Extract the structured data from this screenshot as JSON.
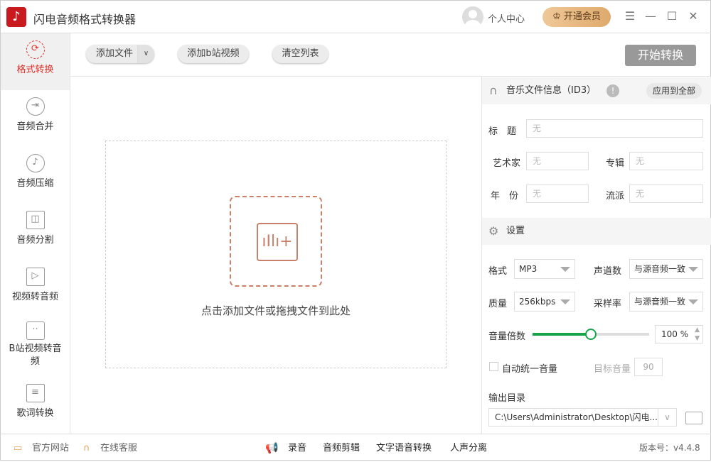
{
  "app": {
    "title": "闪电音频格式转换器",
    "user": "个人中心",
    "vip": "开通会员"
  },
  "sidebar": [
    {
      "label": "格式转换",
      "icon": "refresh-icon"
    },
    {
      "label": "音频合并",
      "icon": "merge-icon"
    },
    {
      "label": "音频压缩",
      "icon": "compress-icon"
    },
    {
      "label": "音频分割",
      "icon": "split-icon"
    },
    {
      "label": "视频转音频",
      "icon": "video-icon"
    },
    {
      "label": "B站视频转音频",
      "icon": "bilibili-icon"
    },
    {
      "label": "歌词转换",
      "icon": "lyrics-icon"
    }
  ],
  "toolbar": {
    "add_file": "添加文件",
    "add_bili": "添加b站视频",
    "clear": "清空列表",
    "start": "开始转换"
  },
  "drop": {
    "text": "点击添加文件或拖拽文件到此处"
  },
  "id3": {
    "header": "音乐文件信息（ID3）",
    "apply_all": "应用到全部",
    "title_label": "标　题",
    "artist_label": "艺术家",
    "album_label": "专辑",
    "year_label": "年　份",
    "genre_label": "流派",
    "placeholder": "无"
  },
  "settings": {
    "header": "设置",
    "format_label": "格式",
    "format": "MP3",
    "channels_label": "声道数",
    "channels": "与源音频一致",
    "quality_label": "质量",
    "quality": "256kbps",
    "samplerate_label": "采样率",
    "samplerate": "与源音频一致",
    "volume_label": "音量倍数",
    "volume": "100",
    "volume_unit": "%",
    "volume_percent": 100,
    "volume_slider_fraction": 0.5,
    "auto_label": "自动统一音量",
    "target_label": "目标音量",
    "target": "90",
    "output_label": "输出目录",
    "output": "C:\\Users\\Administrator\\Desktop\\闪电..."
  },
  "status": {
    "website": "官方网站",
    "support": "在线客服",
    "record": "录音",
    "edit": "音频剪辑",
    "tts": "文字语音转换",
    "vocal": "人声分离",
    "version": "版本号：v4.4.8"
  }
}
